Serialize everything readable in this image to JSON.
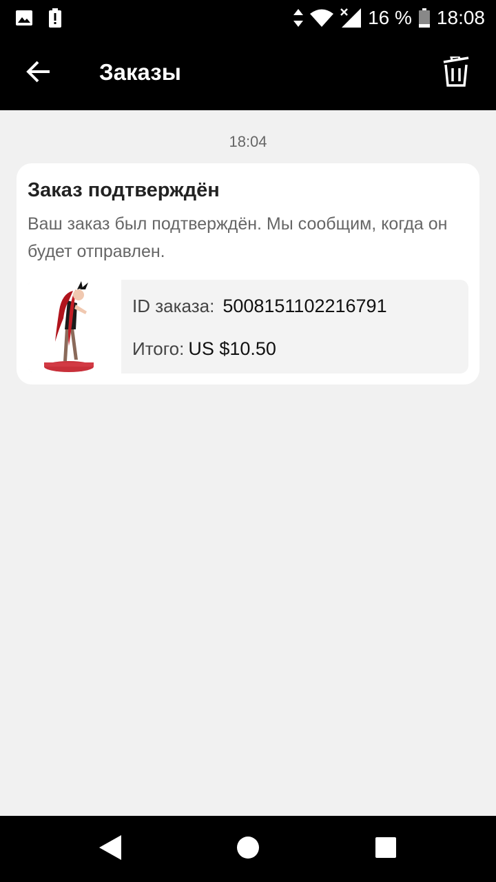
{
  "status_bar": {
    "battery": "16 %",
    "time": "18:08",
    "icons": [
      "image-notification-icon",
      "battery-alert-icon",
      "data-arrows-icon",
      "wifi-icon",
      "signal-off-icon",
      "battery-icon"
    ]
  },
  "app_bar": {
    "title": "Заказы",
    "back_icon": "arrow-left-icon",
    "trash_icon": "trash-icon"
  },
  "message": {
    "time": "18:04",
    "title": "Заказ подтверждён",
    "text": "Ваш заказ был подтверждён. Мы сообщим, когда он будет отправлен.",
    "order": {
      "id_label": "ID заказа:",
      "id_value": "5008151102216791",
      "total_label": "Итого:",
      "total_value": "US $10.50"
    }
  },
  "nav_bar": {
    "icons": [
      "back-triangle-icon",
      "home-circle-icon",
      "recents-square-icon"
    ]
  }
}
